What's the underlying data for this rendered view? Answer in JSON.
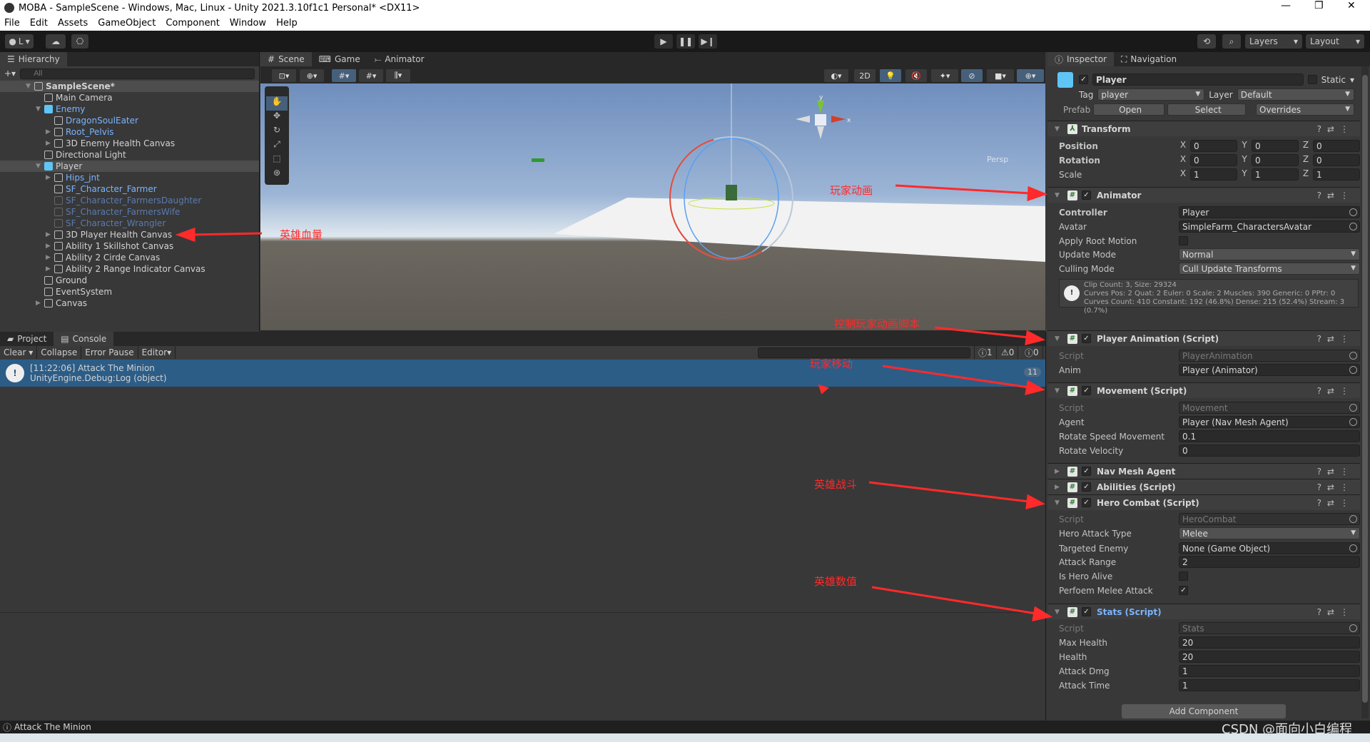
{
  "window": {
    "title": "MOBA - SampleScene - Windows, Mac, Linux - Unity 2021.3.10f1c1 Personal* <DX11>",
    "controls": [
      "—",
      "❐",
      "✕"
    ]
  },
  "menu": [
    "File",
    "Edit",
    "Assets",
    "GameObject",
    "Component",
    "Window",
    "Help"
  ],
  "toolbar": {
    "account": "L",
    "layers": "Layers",
    "layout": "Layout"
  },
  "hierarchy": {
    "tab": "Hierarchy",
    "search_placeholder": "All",
    "items": [
      {
        "label": "SampleScene*",
        "depth": 0,
        "style": "scene",
        "arrow": "▼"
      },
      {
        "label": "Main Camera",
        "depth": 1,
        "style": "normal",
        "arrow": ""
      },
      {
        "label": "Enemy",
        "depth": 1,
        "style": "prefab-root",
        "arrow": "▼"
      },
      {
        "label": "DragonSoulEater",
        "depth": 2,
        "style": "blue",
        "arrow": ""
      },
      {
        "label": "Root_Pelvis",
        "depth": 2,
        "style": "blue",
        "arrow": "▶"
      },
      {
        "label": "3D Enemy Health Canvas",
        "depth": 2,
        "style": "normal",
        "arrow": "▶"
      },
      {
        "label": "Directional Light",
        "depth": 1,
        "style": "normal",
        "arrow": ""
      },
      {
        "label": "Player",
        "depth": 1,
        "style": "prefab-root-selected",
        "arrow": "▼"
      },
      {
        "label": "Hips_jnt",
        "depth": 2,
        "style": "blue",
        "arrow": "▶"
      },
      {
        "label": "SF_Character_Farmer",
        "depth": 2,
        "style": "blue",
        "arrow": ""
      },
      {
        "label": "SF_Character_FarmersDaughter",
        "depth": 2,
        "style": "dim",
        "arrow": ""
      },
      {
        "label": "SF_Character_FarmersWife",
        "depth": 2,
        "style": "dim",
        "arrow": ""
      },
      {
        "label": "SF_Character_Wrangler",
        "depth": 2,
        "style": "dim",
        "arrow": ""
      },
      {
        "label": "3D Player Health Canvas",
        "depth": 2,
        "style": "normal",
        "arrow": "▶"
      },
      {
        "label": "Ability 1 Skillshot Canvas",
        "depth": 2,
        "style": "normal",
        "arrow": "▶"
      },
      {
        "label": "Ability 2 Cirde Canvas",
        "depth": 2,
        "style": "normal",
        "arrow": "▶"
      },
      {
        "label": "Ability 2 Range Indicator Canvas",
        "depth": 2,
        "style": "normal",
        "arrow": "▶"
      },
      {
        "label": "Ground",
        "depth": 1,
        "style": "normal",
        "arrow": ""
      },
      {
        "label": "EventSystem",
        "depth": 1,
        "style": "normal",
        "arrow": ""
      },
      {
        "label": "Canvas",
        "depth": 1,
        "style": "normal",
        "arrow": "▶"
      }
    ]
  },
  "scene": {
    "tabs": [
      "Scene",
      "Game",
      "Animator"
    ],
    "active_tab": "Scene",
    "mode_2d": "2D",
    "persp": "Persp",
    "gizmo_axes": [
      "y",
      "x"
    ]
  },
  "console": {
    "tabs": [
      "Project",
      "Console"
    ],
    "active_tab": "Console",
    "buttons": [
      "Clear",
      "Collapse",
      "Error Pause",
      "Editor"
    ],
    "counts": {
      "log": "1",
      "warn": "0",
      "error": "0"
    },
    "entries": [
      {
        "line1": "[11:22:06] Attack The Minion",
        "line2": "UnityEngine.Debug:Log (object)",
        "count": "11"
      }
    ]
  },
  "status_bar": "Attack The Minion",
  "inspector": {
    "tabs": [
      "Inspector",
      "Navigation"
    ],
    "object": {
      "name": "Player",
      "static_label": "Static",
      "tag_label": "Tag",
      "tag": "player",
      "layer_label": "Layer",
      "layer": "Default",
      "prefab_label": "Prefab",
      "open": "Open",
      "select": "Select",
      "overrides": "Overrides"
    },
    "transform": {
      "title": "Transform",
      "position_label": "Position",
      "rotation_label": "Rotation",
      "scale_label": "Scale",
      "position": [
        "0",
        "0",
        "0"
      ],
      "rotation": [
        "0",
        "0",
        "0"
      ],
      "scale": [
        "1",
        "1",
        "1"
      ],
      "axes": [
        "X",
        "Y",
        "Z"
      ]
    },
    "animator": {
      "title": "Animator",
      "controller_label": "Controller",
      "controller": "Player",
      "avatar_label": "Avatar",
      "avatar": "SimpleFarm_CharactersAvatar",
      "root_motion_label": "Apply Root Motion",
      "root_motion": false,
      "update_mode_label": "Update Mode",
      "update_mode": "Normal",
      "culling_label": "Culling Mode",
      "culling": "Cull Update Transforms",
      "info": [
        "Clip Count: 3, Size: 29324",
        "Curves Pos: 2 Quat: 2 Euler: 0 Scale: 2 Muscles: 390 Generic: 0 PPtr: 0",
        "Curves Count: 410 Constant: 192 (46.8%) Dense: 215 (52.4%) Stream: 3 (0.7%)"
      ]
    },
    "player_animation": {
      "title": "Player Animation (Script)",
      "script_label": "Script",
      "script": "PlayerAnimation",
      "anim_label": "Anim",
      "anim": "Player (Animator)"
    },
    "movement": {
      "title": "Movement (Script)",
      "script_label": "Script",
      "script": "Movement",
      "agent_label": "Agent",
      "agent": "Player (Nav Mesh Agent)",
      "rsm_label": "Rotate Speed Movement",
      "rsm": "0.1",
      "rv_label": "Rotate Velocity",
      "rv": "0"
    },
    "nav_mesh_agent": {
      "title": "Nav Mesh Agent"
    },
    "abilities": {
      "title": "Abilities (Script)"
    },
    "hero_combat": {
      "title": "Hero Combat (Script)",
      "script_label": "Script",
      "script": "HeroCombat",
      "type_label": "Hero Attack Type",
      "type": "Melee",
      "target_label": "Targeted Enemy",
      "target": "None (Game Object)",
      "range_label": "Attack Range",
      "range": "2",
      "alive_label": "Is Hero Alive",
      "alive": false,
      "melee_label": "Perfoem Melee Attack",
      "melee": true
    },
    "stats": {
      "title": "Stats (Script)",
      "script_label": "Script",
      "script": "Stats",
      "maxh_label": "Max Health",
      "maxh": "20",
      "health_label": "Health",
      "health": "20",
      "dmg_label": "Attack Dmg",
      "dmg": "1",
      "time_label": "Attack Time",
      "time": "1"
    },
    "add_component": "Add Component"
  },
  "annotations": {
    "health_bar": "英雄血量",
    "player_anim": "玩家动画",
    "anim_script": "控制玩家动画脚本",
    "movement": "玩家移动",
    "combat": "英雄战斗",
    "stats": "英雄数值"
  },
  "watermark": "CSDN @面向小白编程",
  "colors": {
    "accent": "#2c5d87",
    "annotation": "#ff2a2a",
    "prefab_blue": "#7ab4ff"
  }
}
